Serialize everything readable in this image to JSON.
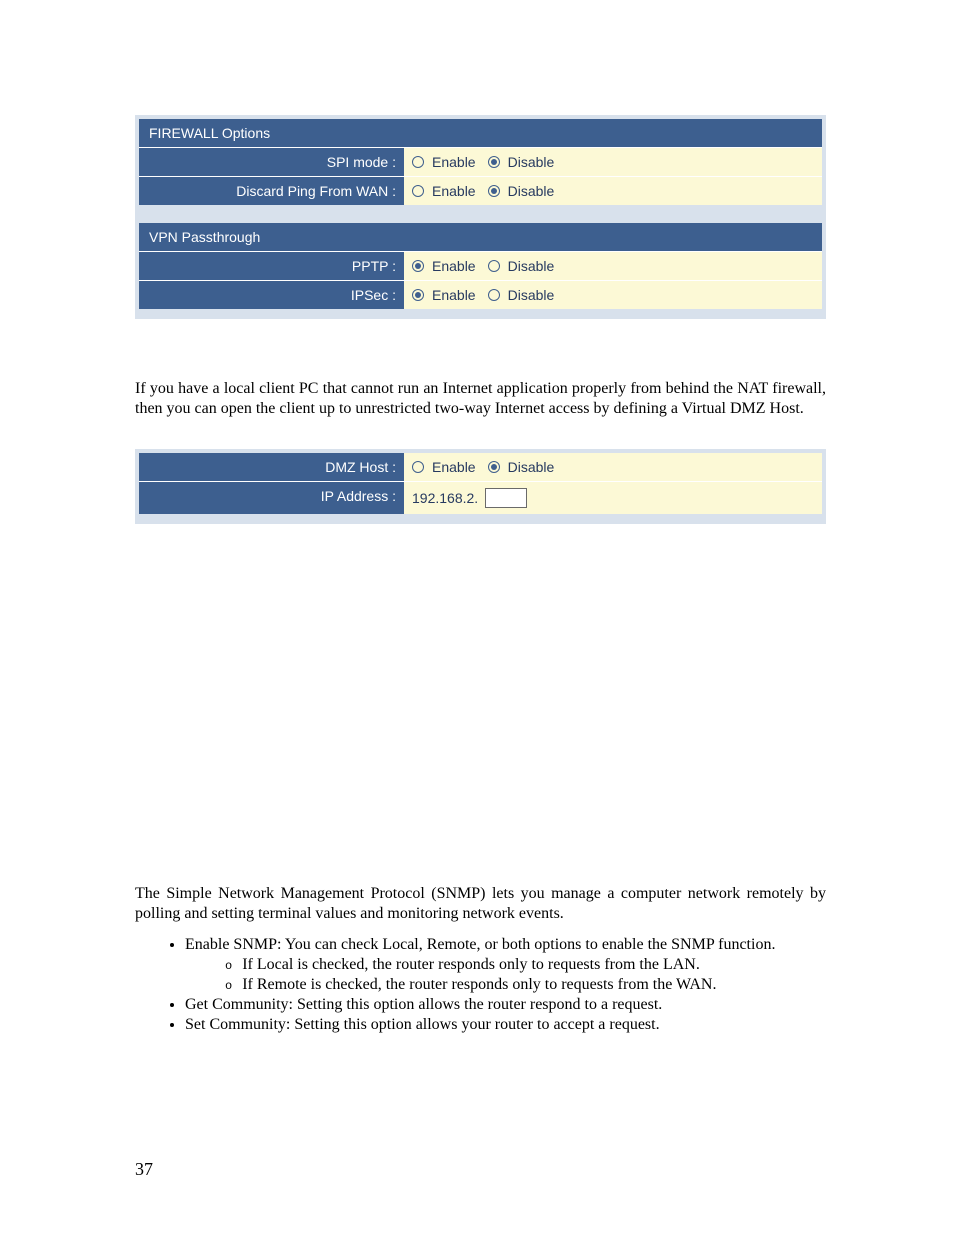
{
  "firewall": {
    "header": "FIREWALL Options",
    "spi_label": "SPI mode :",
    "discard_label": "Discard Ping From WAN :",
    "enable": "Enable",
    "disable": "Disable",
    "spi_selected": "disable",
    "discard_selected": "disable"
  },
  "vpn": {
    "header": "VPN Passthrough",
    "pptp_label": "PPTP :",
    "ipsec_label": "IPSec :",
    "enable": "Enable",
    "disable": "Disable",
    "pptp_selected": "enable",
    "ipsec_selected": "enable"
  },
  "dmz": {
    "intro": "If you have a local client PC that cannot run an Internet application properly from behind the NAT firewall, then you can open the client up to unrestricted two-way Internet access by defining a Virtual DMZ Host.",
    "host_label": "DMZ Host :",
    "ip_label": "IP Address :",
    "enable": "Enable",
    "disable": "Disable",
    "host_selected": "disable",
    "ip_prefix": "192.168.2.",
    "ip_value": ""
  },
  "snmp": {
    "intro": "The Simple Network Management Protocol (SNMP) lets you manage a computer network remotely by polling and setting terminal values and monitoring network events.",
    "bullets": [
      "Enable SNMP: You can check Local, Remote, or both options to enable the SNMP function.",
      "Get Community: Setting this option allows the router respond to a request.",
      "Set Community: Setting this option allows your router to accept a request."
    ],
    "sub_bullets": [
      "If Local is checked, the router responds only to requests from the LAN.",
      "If Remote is checked, the router responds only to requests from the WAN."
    ]
  },
  "page_number": "37"
}
